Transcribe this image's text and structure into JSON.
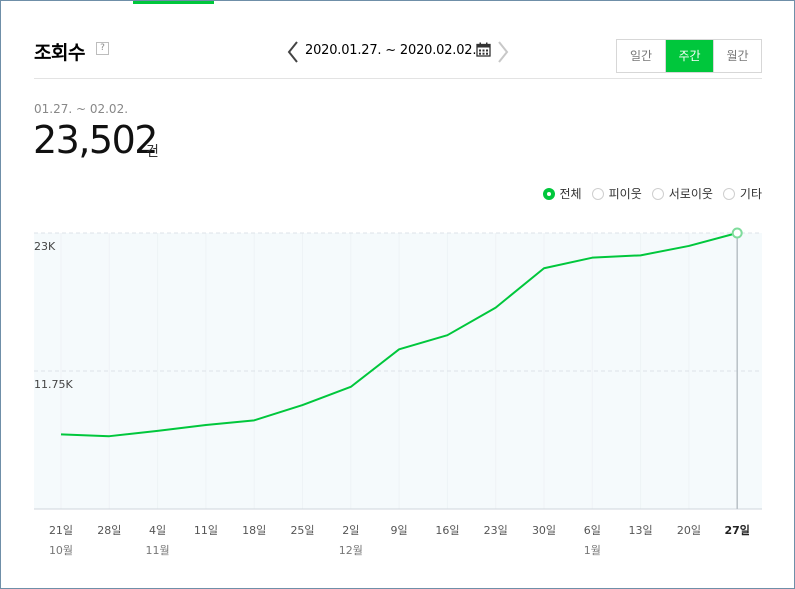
{
  "header": {
    "title": "조회수",
    "help_symbol": "?",
    "date_range": "2020.01.27. ~ 2020.02.02.",
    "period_tabs": [
      {
        "label": "일간",
        "active": false
      },
      {
        "label": "주간",
        "active": true
      },
      {
        "label": "월간",
        "active": false
      }
    ]
  },
  "summary": {
    "period": "01.27. ~ 02.02.",
    "total": "23,502",
    "unit": "건"
  },
  "filters": [
    {
      "label": "전체",
      "checked": true
    },
    {
      "label": "피이웃",
      "checked": false
    },
    {
      "label": "서로이웃",
      "checked": false
    },
    {
      "label": "기타",
      "checked": false
    }
  ],
  "colors": {
    "accent": "#00c73c",
    "plot_background": "#f5fafc",
    "grid": "#dde3e8"
  },
  "chart_data": {
    "type": "line",
    "x": [
      "21일",
      "28일",
      "4일",
      "11일",
      "18일",
      "25일",
      "2일",
      "9일",
      "16일",
      "23일",
      "30일",
      "6일",
      "13일",
      "20일",
      "27일"
    ],
    "month_labels": [
      {
        "index": 0,
        "label": "10월"
      },
      {
        "index": 2,
        "label": "11월"
      },
      {
        "index": 6,
        "label": "12월"
      },
      {
        "index": 11,
        "label": "1월"
      }
    ],
    "series": [
      {
        "values": [
          6350,
          6200,
          6650,
          7150,
          7550,
          8850,
          10400,
          13600,
          14800,
          17150,
          20500,
          21400,
          21600,
          22400,
          23502
        ]
      }
    ],
    "yticks": [
      {
        "value": 23500,
        "label": "23K"
      },
      {
        "value": 11750,
        "label": "11.75K"
      }
    ],
    "ylim": [
      0,
      23502
    ],
    "highlight_index": 14,
    "grid": true
  }
}
